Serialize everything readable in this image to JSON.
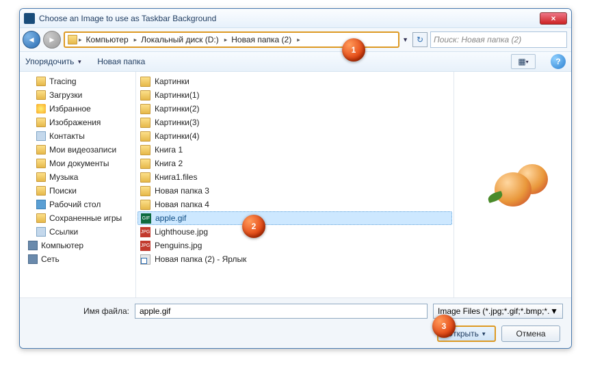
{
  "title": "Choose an Image to use as Taskbar Background",
  "close": "×",
  "breadcrumb": [
    "Компьютер",
    "Локальный диск (D:)",
    "Новая папка (2)"
  ],
  "search_placeholder": "Поиск: Новая папка (2)",
  "toolbar": {
    "organize": "Упорядочить",
    "newfolder": "Новая папка"
  },
  "tree": [
    {
      "label": "Tracing",
      "icon": "ic-folder",
      "lvl": 2
    },
    {
      "label": "Загрузки",
      "icon": "ic-folder",
      "lvl": 2
    },
    {
      "label": "Избранное",
      "icon": "ic-fav",
      "lvl": 2
    },
    {
      "label": "Изображения",
      "icon": "ic-folder",
      "lvl": 2
    },
    {
      "label": "Контакты",
      "icon": "ic-link",
      "lvl": 2
    },
    {
      "label": "Мои видеозаписи",
      "icon": "ic-folder",
      "lvl": 2
    },
    {
      "label": "Мои документы",
      "icon": "ic-folder",
      "lvl": 2
    },
    {
      "label": "Музыка",
      "icon": "ic-folder",
      "lvl": 2
    },
    {
      "label": "Поиски",
      "icon": "ic-folder",
      "lvl": 2
    },
    {
      "label": "Рабочий стол",
      "icon": "ic-desk",
      "lvl": 2
    },
    {
      "label": "Сохраненные игры",
      "icon": "ic-folder",
      "lvl": 2
    },
    {
      "label": "Ссылки",
      "icon": "ic-link",
      "lvl": 2
    },
    {
      "label": "Компьютер",
      "icon": "ic-comp",
      "lvl": 1
    },
    {
      "label": "Сеть",
      "icon": "ic-net",
      "lvl": 1
    }
  ],
  "files": [
    {
      "name": "Картинки",
      "type": "folder"
    },
    {
      "name": "Картинки(1)",
      "type": "folder"
    },
    {
      "name": "Картинки(2)",
      "type": "folder"
    },
    {
      "name": "Картинки(3)",
      "type": "folder"
    },
    {
      "name": "Картинки(4)",
      "type": "folder"
    },
    {
      "name": "Книга 1",
      "type": "folder"
    },
    {
      "name": "Книга 2",
      "type": "folder"
    },
    {
      "name": "Книга1.files",
      "type": "folder"
    },
    {
      "name": "Новая папка 3",
      "type": "folder"
    },
    {
      "name": "Новая папка 4",
      "type": "folder"
    },
    {
      "name": "apple.gif",
      "type": "gif",
      "selected": true
    },
    {
      "name": "Lighthouse.jpg",
      "type": "jpg"
    },
    {
      "name": "Penguins.jpg",
      "type": "jpg"
    },
    {
      "name": "Новая папка (2) - Ярлык",
      "type": "shortcut"
    }
  ],
  "filename_label": "Имя файла:",
  "filename_value": "apple.gif",
  "filter": "Image Files (*.jpg;*.gif;*.bmp;*.",
  "open": "Открыть",
  "cancel": "Отмена",
  "callouts": {
    "c1": "1",
    "c2": "2",
    "c3": "3"
  }
}
